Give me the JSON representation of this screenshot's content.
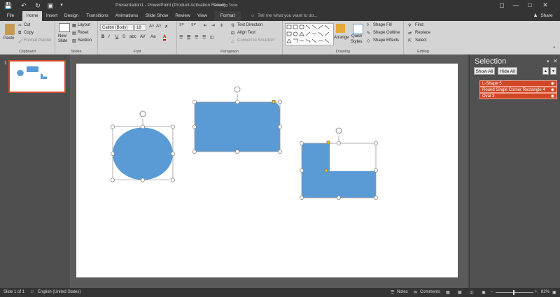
{
  "window": {
    "title": "Presentation1 - PowerPoint (Product Activation Failed)",
    "contextual": "Drawing Tools",
    "search_placeholder": "Tell me what you want to do...",
    "user": "Share"
  },
  "tabs": [
    "File",
    "Home",
    "Insert",
    "Design",
    "Transitions",
    "Animations",
    "Slide Show",
    "Review",
    "View",
    "Format"
  ],
  "ribbon": {
    "clipboard": {
      "label": "Clipboard",
      "paste": "Paste",
      "cut": "Cut",
      "copy": "Copy",
      "format_painter": "Format Painter"
    },
    "slides": {
      "label": "Slides",
      "new_slide_1": "New",
      "new_slide_2": "Slide",
      "layout": "Layout",
      "reset": "Reset",
      "section": "Section"
    },
    "font": {
      "label": "Font",
      "name": "Calibri (Body)",
      "size": "18",
      "bold": "B",
      "italic": "I",
      "underline": "U",
      "strike": "S",
      "shadow": "abc",
      "spacing": "AV",
      "case": "Aa",
      "color": "A"
    },
    "paragraph": {
      "label": "Paragraph",
      "text_direction": "Text Direction",
      "align_text": "Align Text",
      "smartart": "Convert to SmartArt"
    },
    "drawing": {
      "label": "Drawing",
      "arrange": "Arrange",
      "quick_1": "Quick",
      "quick_2": "Styles",
      "shape_fill": "Shape Fill",
      "shape_outline": "Shape Outline",
      "shape_effects": "Shape Effects"
    },
    "editing": {
      "label": "Editing",
      "find": "Find",
      "replace": "Replace",
      "select": "Select"
    }
  },
  "thumbnail": {
    "number": "1"
  },
  "selection_pane": {
    "title": "Selection",
    "show_all": "Show All",
    "hide_all": "Hide All",
    "items": [
      "L-Shape 5",
      "Round Single Corner Rectangle 4",
      "Oval 3"
    ]
  },
  "status": {
    "slide": "Slide 1 of 1",
    "language": "English (United States)",
    "notes": "Notes",
    "comments": "Comments",
    "zoom": "82%"
  },
  "colors": {
    "shape_fill": "#5b9bd5",
    "selection_accent": "#d24726",
    "title_bar": "#343434",
    "ribbon": "#d4d4d4"
  }
}
